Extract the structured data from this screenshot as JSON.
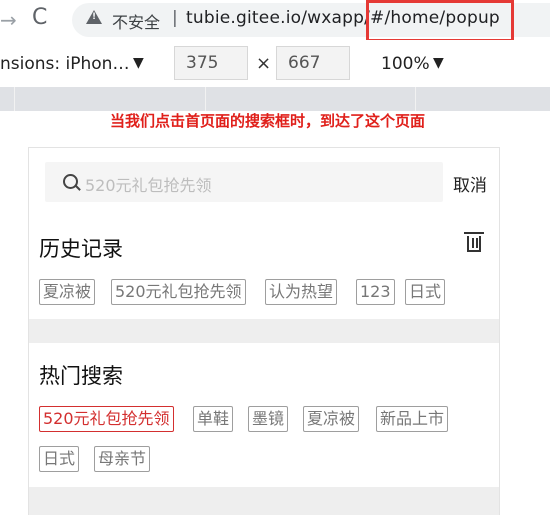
{
  "browser": {
    "nav_arrow": "→",
    "reload": "C",
    "security_label": "不安全",
    "separator": "|",
    "url": "tubie.gitee.io/wxapp/#/home/popup"
  },
  "device_toolbar": {
    "device": "nsions: iPhon…",
    "caret": "▼",
    "width": "375",
    "x": "×",
    "height": "667",
    "zoom": "100%"
  },
  "annotation": "当我们点击首页面的搜索框时，到达了这个页面",
  "search": {
    "placeholder": "520元礼包抢先领",
    "cancel": "取消"
  },
  "history": {
    "title": "历史记录",
    "tags": [
      "夏凉被",
      "520元礼包抢先领",
      "认为热望",
      "123",
      "日式"
    ]
  },
  "hot": {
    "title": "热门搜索",
    "tags": [
      "520元礼包抢先领",
      "单鞋",
      "墨镜",
      "夏凉被",
      "新品上市",
      "日式",
      "母亲节"
    ]
  },
  "colors": {
    "annotation": "#e0201b",
    "highlight_border": "#e53935",
    "hot_tag": "#d32f2f"
  }
}
